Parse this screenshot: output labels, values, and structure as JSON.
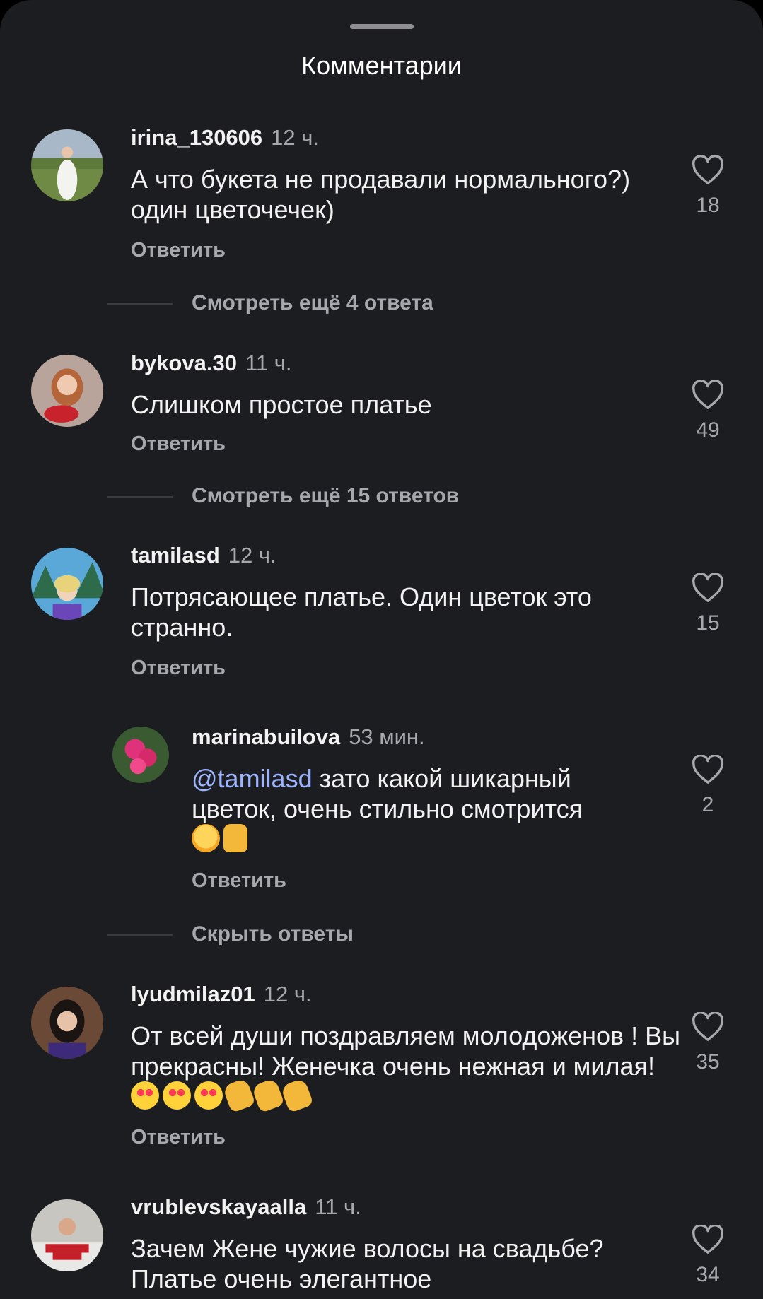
{
  "header": {
    "title": "Комментарии"
  },
  "comments": [
    {
      "username": "irina_130606",
      "time": "12 ч.",
      "text": "А что букета не продавали нормального?) один цветочечек)",
      "reply_label": "Ответить",
      "likes": "18",
      "thread_label": "Смотреть ещё 4 ответа"
    },
    {
      "username": "bykova.30",
      "time": "11 ч.",
      "text": "Слишком простое платье",
      "reply_label": "Ответить",
      "likes": "49",
      "thread_label": "Смотреть ещё 15 ответов"
    },
    {
      "username": "tamilasd",
      "time": "12 ч.",
      "text": "Потрясающее платье. Один цветок это странно.",
      "reply_label": "Ответить",
      "likes": "15"
    },
    {
      "username": "marinabuilova",
      "time": "53 мин.",
      "mention": "@tamilasd",
      "text": " зато какой шикарный цветок, очень стильно смотрится",
      "emojis": [
        "hugging-face-emoji",
        "thumbs-up-emoji"
      ],
      "reply_label": "Ответить",
      "likes": "2",
      "thread_label": "Скрыть ответы"
    },
    {
      "username": "lyudmilaz01",
      "time": "12 ч.",
      "text": "От всей души поздравляем молодоженов ! Вы прекрасны! Женечка очень нежная и милая! ",
      "emojis": [
        "heart-eyes-emoji",
        "heart-eyes-emoji",
        "heart-eyes-emoji",
        "clapping-hands-emoji",
        "clapping-hands-emoji",
        "clapping-hands-emoji"
      ],
      "reply_label": "Ответить",
      "likes": "35"
    },
    {
      "username": "vrublevskayaalla",
      "time": "11 ч.",
      "text": "Зачем Жене чужие волосы на свадьбе? Платье очень элегантное",
      "likes": "34"
    }
  ],
  "icons": {
    "like": "heart-outline-icon"
  },
  "colors": {
    "background": "#1c1d21",
    "secondary_text": "#a7a8ad",
    "mention": "#9db4ff"
  }
}
